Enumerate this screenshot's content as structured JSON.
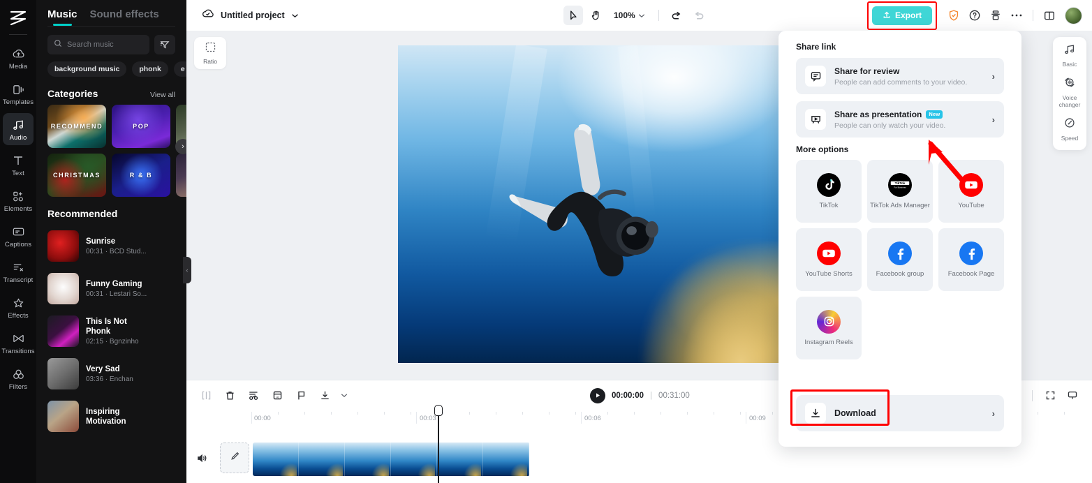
{
  "app": {
    "name": "CapCut Web Editor"
  },
  "rail": {
    "logo_icon": "capcut-logo-icon",
    "items": [
      {
        "label": "Media",
        "icon": "cloud-upload-icon",
        "active": false
      },
      {
        "label": "Templates",
        "icon": "template-icon",
        "active": false
      },
      {
        "label": "Audio",
        "icon": "music-note-icon",
        "active": true
      },
      {
        "label": "Text",
        "icon": "text-t-icon",
        "active": false
      },
      {
        "label": "Elements",
        "icon": "elements-icon",
        "active": false
      },
      {
        "label": "Captions",
        "icon": "captions-icon",
        "active": false
      },
      {
        "label": "Transcript",
        "icon": "transcript-icon",
        "active": false
      },
      {
        "label": "Effects",
        "icon": "sparkle-icon",
        "active": false
      },
      {
        "label": "Transitions",
        "icon": "transitions-icon",
        "active": false
      },
      {
        "label": "Filters",
        "icon": "filters-icon",
        "active": false
      }
    ]
  },
  "panel": {
    "tabs": [
      {
        "label": "Music",
        "active": true
      },
      {
        "label": "Sound effects",
        "active": false
      }
    ],
    "search": {
      "placeholder": "Search music",
      "value": "",
      "icon": "search-icon"
    },
    "filter_icon": "sort-filter-icon",
    "chips": [
      "background music",
      "phonk"
    ],
    "categories": {
      "title": "Categories",
      "view_all": "View all",
      "items": [
        {
          "label": "RECOMMEND",
          "theme": "c-recommend"
        },
        {
          "label": "POP",
          "theme": "c-pop"
        },
        {
          "label": "",
          "theme": "c-third1"
        },
        {
          "label": "CHRISTMAS",
          "theme": "c-christmas"
        },
        {
          "label": "R & B",
          "theme": "c-rb"
        },
        {
          "label": "",
          "theme": "c-third2"
        }
      ],
      "next_icon": "chevron-right-icon"
    },
    "recommended": {
      "title": "Recommended",
      "items": [
        {
          "name": "Sunrise",
          "meta": "00:31 · BCD Stud...",
          "theme": "t-sunrise"
        },
        {
          "name": "Funny Gaming",
          "meta": "00:31 · Lestari So...",
          "theme": "t-funny"
        },
        {
          "name": "This Is Not Phonk",
          "meta": "02:15 · Bgnzinho",
          "theme": "t-phonk"
        },
        {
          "name": "Very Sad",
          "meta": "03:36 · Enchan",
          "theme": "t-verysad"
        },
        {
          "name": "Inspiring Motivation",
          "meta": "",
          "theme": "t-inspiring"
        }
      ]
    },
    "collapse_icon": "chevron-left-icon"
  },
  "topbar": {
    "cloud_icon": "cloud-saved-icon",
    "project_name": "Untitled project",
    "project_chevron": "chevron-down-icon",
    "select_tool_icon": "cursor-select-icon",
    "hand_tool_icon": "hand-pan-icon",
    "zoom_level": "100%",
    "zoom_chevron": "chevron-down-icon",
    "undo_icon": "undo-icon",
    "redo_icon": "redo-icon",
    "export_label": "Export",
    "export_icon": "upload-icon",
    "export_color": "#3fd6d6",
    "highlight_color": "#ff0000",
    "shield_icon": "shield-check-icon",
    "help_icon": "question-circle-icon",
    "print_icon": "layers-stack-icon",
    "more_icon": "more-dots-icon",
    "layout_icon": "split-layout-icon",
    "avatar_icon": "user-avatar"
  },
  "canvas": {
    "ratio_label": "Ratio",
    "ratio_icon": "crop-ratio-icon"
  },
  "timeline": {
    "tools": [
      {
        "icon": "split-clip-icon",
        "name": "split",
        "disabled": true
      },
      {
        "icon": "trash-icon",
        "name": "delete",
        "disabled": false
      },
      {
        "icon": "auto-cut-icon",
        "name": "auto-cut",
        "disabled": false
      },
      {
        "icon": "ai-frame-icon",
        "name": "ai-frame",
        "disabled": false
      },
      {
        "icon": "flag-marker-icon",
        "name": "marker",
        "disabled": false
      },
      {
        "icon": "download-icon",
        "name": "download",
        "disabled": false
      },
      {
        "icon": "chevron-down-icon",
        "name": "download-menu",
        "disabled": false
      }
    ],
    "play_icon": "play-icon",
    "current_time": "00:00:00",
    "separator": "|",
    "total_time": "00:31:00",
    "right_tools": [
      {
        "icon": "zoom-out-icon",
        "name": "zoom-out"
      },
      {
        "icon": "fit-screen-icon",
        "name": "fit-screen"
      },
      {
        "icon": "presentation-icon",
        "name": "preview-mode"
      }
    ],
    "ruler_labels": [
      "00:00",
      "00:03",
      "00:06",
      "00:09"
    ],
    "track_volume_icon": "volume-icon",
    "track_edit_icon": "pencil-edit-icon",
    "playhead_position": "00:00"
  },
  "right_tools": [
    {
      "label": "Basic",
      "icon": "music-note-icon"
    },
    {
      "label": "Voice\nchanger",
      "icon": "voice-changer-icon",
      "line1": "Voice",
      "line2": "changer"
    },
    {
      "label": "Speed",
      "icon": "speed-gauge-icon"
    }
  ],
  "share_popover": {
    "share_link_title": "Share link",
    "rows": [
      {
        "title": "Share for review",
        "subtitle": "People can add comments to your video.",
        "icon": "comment-bubble-icon",
        "badge": "",
        "chevron": "›"
      },
      {
        "title": "Share as presentation",
        "subtitle": "People can only watch your video.",
        "icon": "presentation-screen-icon",
        "badge": "New",
        "chevron": "›"
      }
    ],
    "more_options_title": "More options",
    "options": [
      {
        "label": "TikTok",
        "icon": "tiktok-logo-icon",
        "logo": "lg-tiktok"
      },
      {
        "label": "TikTok Ads Manager",
        "icon": "tiktok-ads-logo-icon",
        "logo": "lg-tiktok"
      },
      {
        "label": "YouTube",
        "icon": "youtube-logo-icon",
        "logo": "lg-yt"
      },
      {
        "label": "YouTube Shorts",
        "icon": "youtube-shorts-logo-icon",
        "logo": "lg-yt"
      },
      {
        "label": "Facebook group",
        "icon": "facebook-logo-icon",
        "logo": "lg-fb"
      },
      {
        "label": "Facebook Page",
        "icon": "facebook-logo-icon",
        "logo": "lg-fb"
      },
      {
        "label": "Instagram Reels",
        "icon": "instagram-logo-icon",
        "logo": "lg-ig"
      }
    ],
    "download": {
      "label": "Download",
      "icon": "download-icon",
      "chevron": "›"
    },
    "badge_color": "#27c4e8",
    "highlight_color": "#ff0000",
    "arrow_annotation_color": "#ff0000"
  }
}
